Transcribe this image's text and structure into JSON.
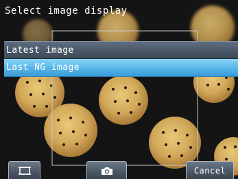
{
  "header": {
    "title": "Select image display"
  },
  "menu": {
    "items": [
      {
        "label": "Latest image",
        "state": "normal"
      },
      {
        "label": "Last NG image",
        "state": "selected"
      }
    ]
  },
  "toolbar": {
    "frame_icon": "frame-adjust-icon",
    "camera_icon": "camera-icon",
    "cancel_label": "Cancel"
  },
  "colors": {
    "menu_normal": "#4a5868",
    "menu_selected": "#5ab8ea",
    "button": "#4c5866",
    "background": "#111111"
  }
}
